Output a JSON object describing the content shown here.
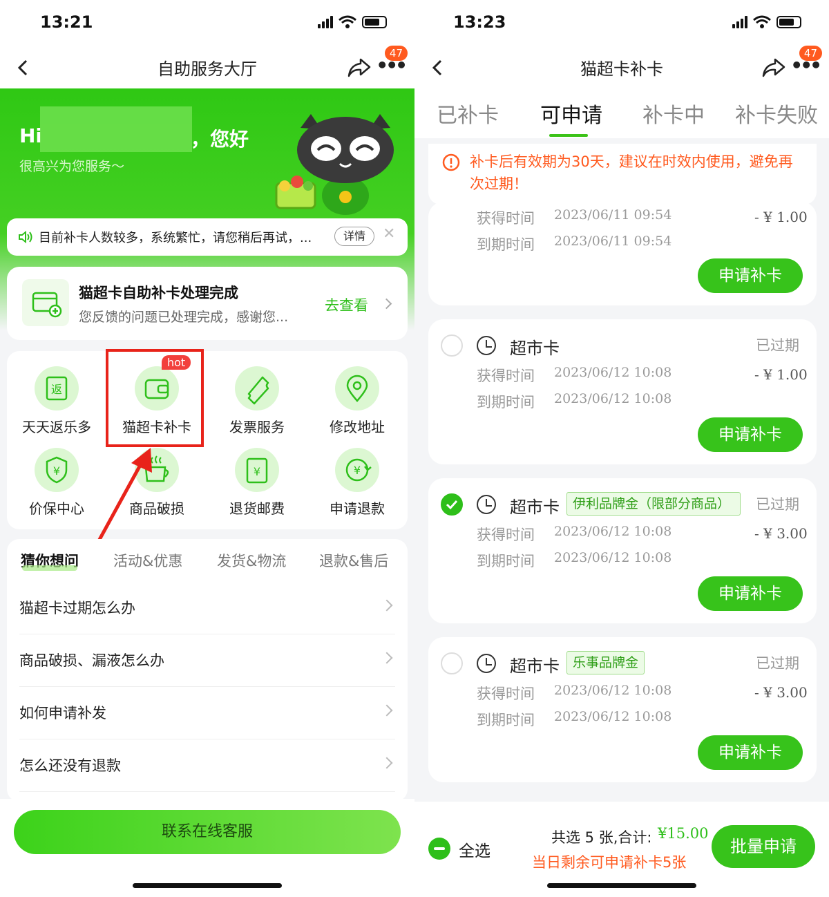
{
  "left": {
    "status": {
      "time": "13:21"
    },
    "nav": {
      "title": "自助服务大厅",
      "badge": "47"
    },
    "hero": {
      "hi": "Hi",
      "greeting": "，您好",
      "subtitle": "很高兴为您服务～"
    },
    "notice": {
      "text": "目前补卡人数较多，系统繁忙，请您稍后再试，...",
      "detail": "详情"
    },
    "result": {
      "title": "猫超卡自助补卡处理完成",
      "desc": "您反馈的问题已处理完成，感谢您...",
      "action": "去查看"
    },
    "grid": {
      "hot": "hot",
      "items": [
        {
          "label": "天天返乐多",
          "icon": "返"
        },
        {
          "label": "猫超卡补卡",
          "icon": "wallet"
        },
        {
          "label": "发票服务",
          "icon": "ticket"
        },
        {
          "label": "修改地址",
          "icon": "pin"
        },
        {
          "label": "价保中心",
          "icon": "¥"
        },
        {
          "label": "商品破损",
          "icon": "cup"
        },
        {
          "label": "退货邮费",
          "icon": "¥"
        },
        {
          "label": "申请退款",
          "icon": "¥"
        }
      ]
    },
    "faq": {
      "tabs": [
        "猜你想问",
        "活动&优惠",
        "发货&物流",
        "退款&售后"
      ],
      "rows": [
        "猫超卡过期怎么办",
        "商品破损、漏液怎么办",
        "如何申请补发",
        "怎么还没有退款"
      ]
    },
    "contact_button": "联系在线客服",
    "colors": {
      "primary": "#3cc318",
      "highlight": "#e8231a"
    }
  },
  "right": {
    "status": {
      "time": "13:23"
    },
    "nav": {
      "title": "猫超卡补卡",
      "badge": "47"
    },
    "tabs": [
      "已补卡",
      "可申请",
      "补卡中",
      "补卡失败"
    ],
    "active_tab": "可申请",
    "warning": "补卡后有效期为30天，建议在时效内使用，避免再次过期！",
    "labels": {
      "get": "获得时间",
      "expire": "到期时间",
      "apply": "申请补卡"
    },
    "cards": [
      {
        "get_time": "2023/06/11 09:54",
        "expire_time": "2023/06/11 09:54",
        "amount": "- ¥ 1.00"
      },
      {
        "name": "超市卡",
        "tag": "",
        "status": "已过期",
        "get_time": "2023/06/12 10:08",
        "expire_time": "2023/06/12 10:08",
        "amount": "- ¥ 1.00",
        "checked": false
      },
      {
        "name": "超市卡",
        "tag": "伊利品牌金（限部分商品）",
        "status": "已过期",
        "get_time": "2023/06/12 10:08",
        "expire_time": "2023/06/12 10:08",
        "amount": "- ¥ 3.00",
        "checked": true
      },
      {
        "name": "超市卡",
        "tag": "乐事品牌金",
        "status": "已过期",
        "get_time": "2023/06/12 10:08",
        "expire_time": "2023/06/12 10:08",
        "amount": "- ¥ 3.00",
        "checked": false
      }
    ],
    "footer": {
      "select_all": "全选",
      "summary": "共选 5 张,合计:",
      "total": "¥15.00",
      "remain": "当日剩余可申请补卡5张",
      "batch": "批量申请"
    }
  }
}
